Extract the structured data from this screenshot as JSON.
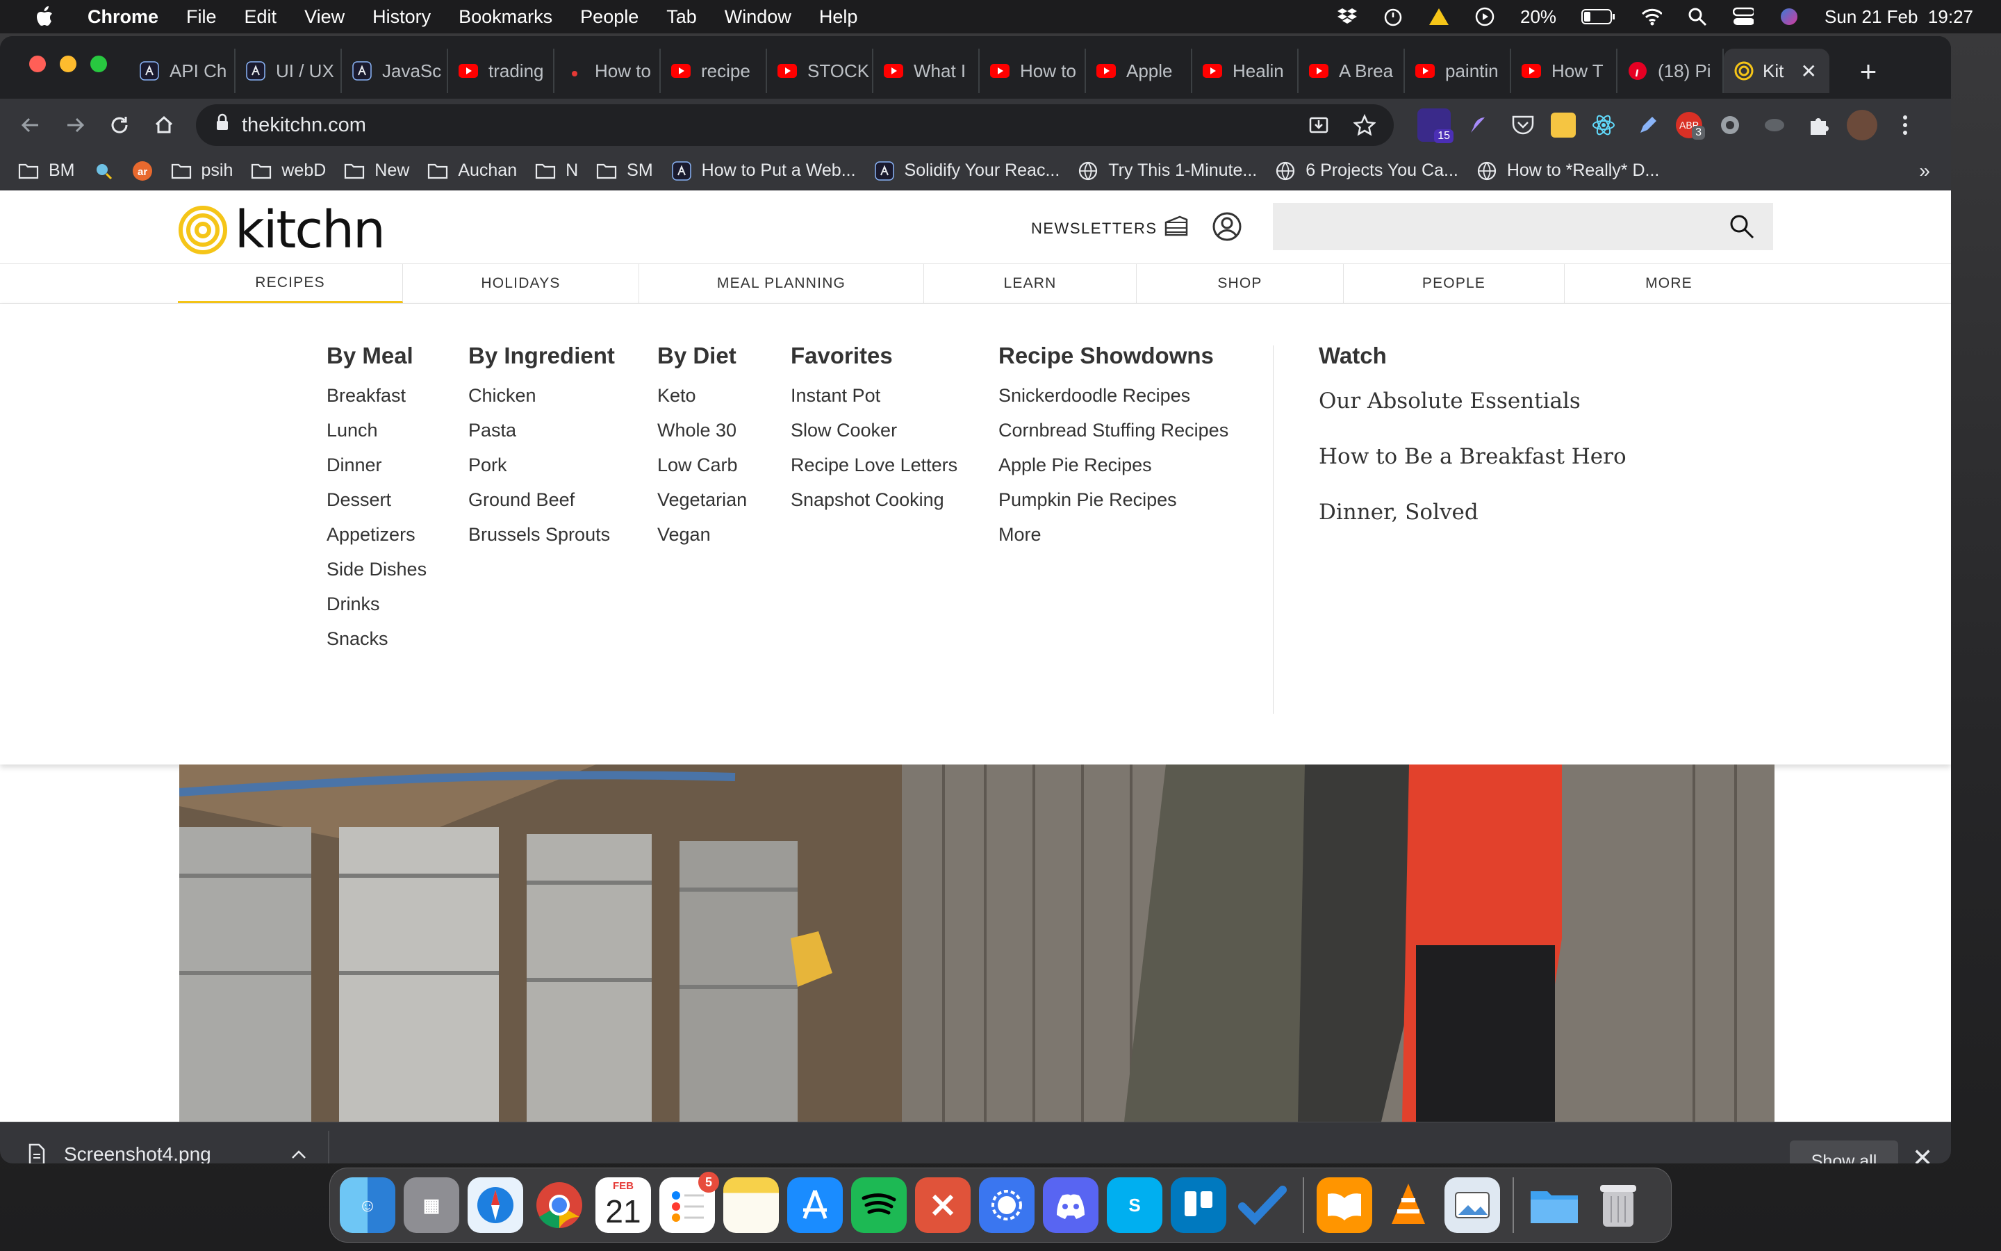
{
  "menubar": {
    "app": "Chrome",
    "items": [
      "File",
      "Edit",
      "View",
      "History",
      "Bookmarks",
      "People",
      "Tab",
      "Window",
      "Help"
    ],
    "battery": "20%",
    "datetime": "Sun 21 Feb  19:27"
  },
  "tabs": [
    {
      "label": "API Ch",
      "icon": "a-icon"
    },
    {
      "label": "UI / UX",
      "icon": "a-icon"
    },
    {
      "label": "JavaSc",
      "icon": "a-icon"
    },
    {
      "label": "trading",
      "icon": "youtube-icon"
    },
    {
      "label": "How to",
      "icon": "dot-icon"
    },
    {
      "label": "recipe",
      "icon": "youtube-icon"
    },
    {
      "label": "STOCK",
      "icon": "youtube-icon"
    },
    {
      "label": "What I",
      "icon": "youtube-icon"
    },
    {
      "label": "How to",
      "icon": "youtube-icon"
    },
    {
      "label": "Apple",
      "icon": "youtube-icon"
    },
    {
      "label": "Healin",
      "icon": "youtube-icon"
    },
    {
      "label": "A Brea",
      "icon": "youtube-icon"
    },
    {
      "label": "paintin",
      "icon": "youtube-icon"
    },
    {
      "label": "How T",
      "icon": "youtube-icon"
    },
    {
      "label": "(18) Pi",
      "icon": "pinterest-icon"
    }
  ],
  "active_tab": {
    "label": "Kit"
  },
  "address": {
    "url": "thekitchn.com"
  },
  "extensions": {
    "badge1": "15",
    "badge2": "3",
    "abp": "ABP"
  },
  "bookmarks": [
    {
      "label": "BM",
      "icon": "folder-icon"
    },
    {
      "label": "",
      "icon": "search-ext-icon"
    },
    {
      "label": "",
      "icon": "ar-icon"
    },
    {
      "label": "psih",
      "icon": "folder-icon"
    },
    {
      "label": "webD",
      "icon": "folder-icon"
    },
    {
      "label": "New",
      "icon": "folder-icon"
    },
    {
      "label": "Auchan",
      "icon": "folder-icon"
    },
    {
      "label": "N",
      "icon": "folder-icon"
    },
    {
      "label": "SM",
      "icon": "folder-icon"
    },
    {
      "label": "How to Put a Web...",
      "icon": "a-icon"
    },
    {
      "label": "Solidify Your Reac...",
      "icon": "a-icon"
    },
    {
      "label": "Try This 1-Minute...",
      "icon": "globe-icon"
    },
    {
      "label": "6 Projects You Ca...",
      "icon": "globe-icon"
    },
    {
      "label": "How to *Really* D...",
      "icon": "globe-icon"
    }
  ],
  "bookmarks_more": "»",
  "site": {
    "logo": "kitchn",
    "newsletters": "NEWSLETTERS",
    "nav": [
      "RECIPES",
      "HOLIDAYS",
      "MEAL PLANNING",
      "LEARN",
      "SHOP",
      "PEOPLE",
      "MORE"
    ]
  },
  "dropdown": {
    "columns": [
      {
        "title": "By Meal",
        "links": [
          "Breakfast",
          "Lunch",
          "Dinner",
          "Dessert",
          "Appetizers",
          "Side Dishes",
          "Drinks",
          "Snacks"
        ]
      },
      {
        "title": "By Ingredient",
        "links": [
          "Chicken",
          "Pasta",
          "Pork",
          "Ground Beef",
          "Brussels Sprouts"
        ]
      },
      {
        "title": "By Diet",
        "links": [
          "Keto",
          "Whole 30",
          "Low Carb",
          "Vegetarian",
          "Vegan"
        ]
      },
      {
        "title": "Favorites",
        "links": [
          "Instant Pot",
          "Slow Cooker",
          "Recipe Love Letters",
          "Snapshot Cooking"
        ]
      },
      {
        "title": "Recipe Showdowns",
        "links": [
          "Snickerdoodle Recipes",
          "Cornbread Stuffing Recipes",
          "Apple Pie Recipes",
          "Pumpkin Pie Recipes",
          "More"
        ]
      }
    ],
    "watch": {
      "title": "Watch",
      "links": [
        "Our Absolute Essentials",
        "How to Be a Breakfast Hero",
        "Dinner, Solved"
      ]
    }
  },
  "download": {
    "filename": "Screenshot4.png",
    "show_all": "Show all"
  },
  "dock": {
    "apps": [
      "finder",
      "launchpad",
      "safari",
      "chrome",
      "calendar",
      "reminders",
      "notes",
      "app-store",
      "spotify",
      "git",
      "signal",
      "discord",
      "skype",
      "trello",
      "todo",
      "books",
      "vlc",
      "preview",
      "folder",
      "trash"
    ],
    "calendar_month": "FEB",
    "calendar_day": "21",
    "reminders_badge": "5"
  }
}
